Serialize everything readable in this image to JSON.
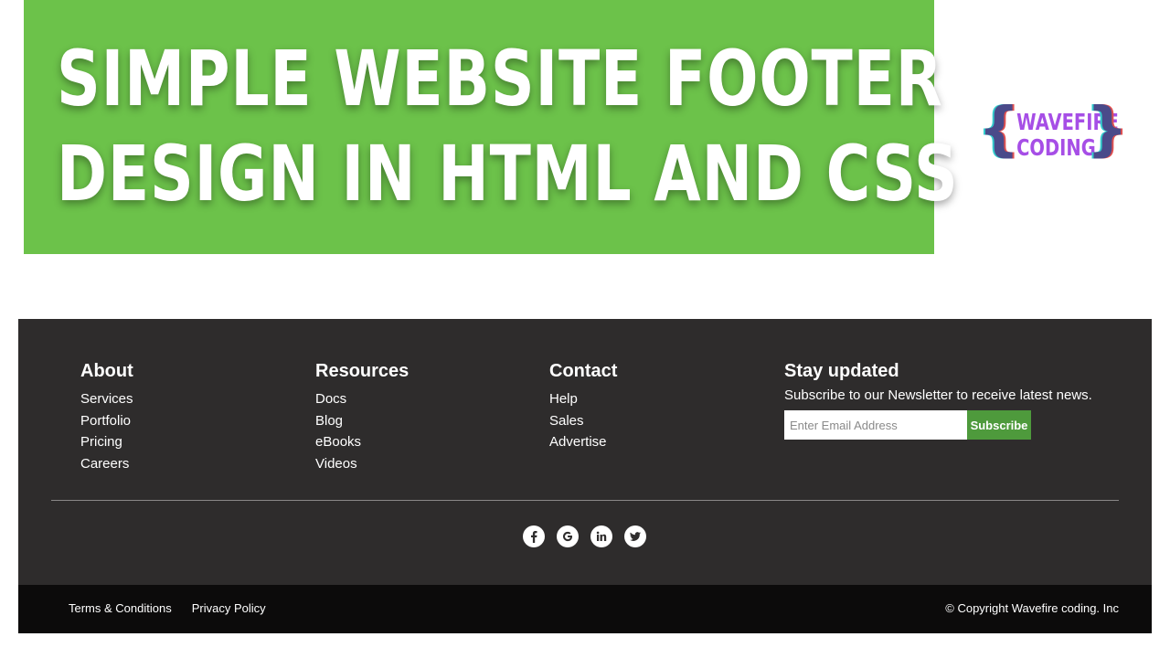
{
  "banner": {
    "line1": "SIMPLE WEBSITE FOOTER",
    "line2": "DESIGN IN HTML AND CSS",
    "bg_color": "#6cc24a"
  },
  "logo": {
    "line1": "WAVEFIRE",
    "line2": "CODING",
    "brace_left": "{",
    "brace_right": "}"
  },
  "footer": {
    "bg_color": "#2e2c2c",
    "columns": [
      {
        "title": "About",
        "items": [
          "Services",
          "Portfolio",
          "Pricing",
          "Careers"
        ]
      },
      {
        "title": "Resources",
        "items": [
          "Docs",
          "Blog",
          "eBooks",
          "Videos"
        ]
      },
      {
        "title": "Contact",
        "items": [
          "Help",
          "Sales",
          "Advertise"
        ]
      }
    ],
    "stay_updated": {
      "title": "Stay updated",
      "description": "Subscribe to our Newsletter to receive latest news.",
      "email_placeholder": "Enter Email Address",
      "subscribe_label": "Subscribe",
      "button_color": "#4e9a3c"
    },
    "socials": [
      "facebook-icon",
      "google-icon",
      "linkedin-icon",
      "twitter-icon"
    ]
  },
  "bottom_bar": {
    "bg_color": "#0c0b0b",
    "links": [
      "Terms & Conditions",
      "Privacy Policy"
    ],
    "copyright": "© Copyright Wavefire coding. Inc"
  }
}
